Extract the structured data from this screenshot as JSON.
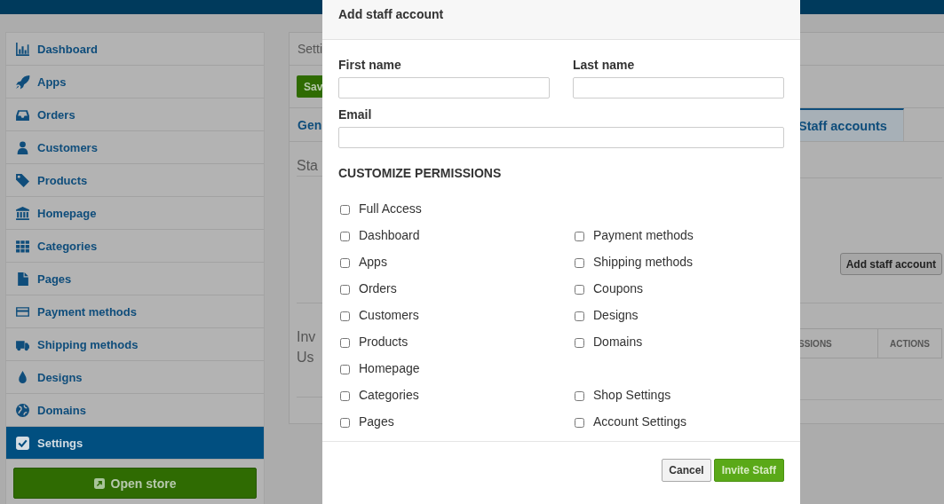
{
  "sidebar": {
    "items": [
      {
        "label": "Dashboard",
        "selected": false
      },
      {
        "label": "Apps",
        "selected": false
      },
      {
        "label": "Orders",
        "selected": false
      },
      {
        "label": "Customers",
        "selected": false
      },
      {
        "label": "Products",
        "selected": false
      },
      {
        "label": "Homepage",
        "selected": false
      },
      {
        "label": "Categories",
        "selected": false
      },
      {
        "label": "Pages",
        "selected": false
      },
      {
        "label": "Payment methods",
        "selected": false
      },
      {
        "label": "Shipping methods",
        "selected": false
      },
      {
        "label": "Designs",
        "selected": false
      },
      {
        "label": "Domains",
        "selected": false
      },
      {
        "label": "Settings",
        "selected": true
      }
    ],
    "open_store_button": "Open store"
  },
  "background_panel": {
    "title": "Setti",
    "save_button": "Sav",
    "tabs": [
      {
        "label": "Gen",
        "selected": false
      },
      {
        "label": "Staff accounts",
        "selected": true
      }
    ],
    "section_heading": "Sta",
    "add_button": "Add staff account",
    "invite_text": [
      "Inv",
      "Us"
    ],
    "table_columns": [
      "SSIONS",
      "ACTIONS"
    ]
  },
  "modal": {
    "title": "Add staff account",
    "first_name_label": "First name",
    "last_name_label": "Last name",
    "email_label": "Email",
    "permissions_heading": "CUSTOMIZE PERMISSIONS",
    "permission_rows": [
      {
        "left": {
          "label": "Full Access",
          "checked": false
        }
      },
      {
        "left": {
          "label": "Dashboard",
          "checked": false
        },
        "right": {
          "label": "Payment methods",
          "checked": false
        }
      },
      {
        "left": {
          "label": "Apps",
          "checked": false
        },
        "right": {
          "label": "Shipping methods",
          "checked": false
        }
      },
      {
        "left": {
          "label": "Orders",
          "checked": false
        },
        "right": {
          "label": "Coupons",
          "checked": false
        }
      },
      {
        "left": {
          "label": "Customers",
          "checked": false
        },
        "right": {
          "label": "Designs",
          "checked": false
        }
      },
      {
        "left": {
          "label": "Products",
          "checked": false
        },
        "right": {
          "label": "Domains",
          "checked": false
        }
      },
      {
        "left": {
          "label": "Homepage",
          "checked": false
        }
      },
      {
        "left": {
          "label": "Categories",
          "checked": false
        },
        "right": {
          "label": "Shop Settings",
          "checked": false
        }
      },
      {
        "left": {
          "label": "Pages",
          "checked": false
        },
        "right": {
          "label": "Account Settings",
          "checked": false
        }
      }
    ],
    "cancel_button": "Cancel",
    "invite_button": "Invite Staff"
  }
}
